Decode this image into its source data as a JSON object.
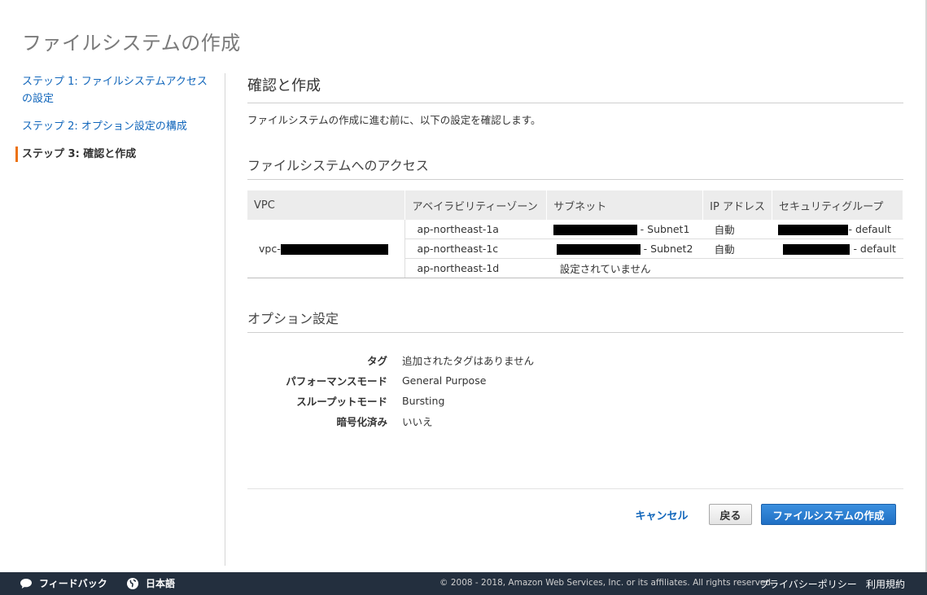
{
  "page_title": "ファイルシステムの作成",
  "sidebar": {
    "steps": [
      {
        "label": "ステップ 1: ファイルシステムアクセスの設定"
      },
      {
        "label": "ステップ 2: オプション設定の構成"
      },
      {
        "label": "ステップ 3: 確認と作成"
      }
    ]
  },
  "section": {
    "title": "確認と作成",
    "description": "ファイルシステムの作成に進む前に、以下の設定を確認します。"
  },
  "access": {
    "title": "ファイルシステムへのアクセス",
    "columns": [
      "VPC",
      "アベイラビリティーゾーン",
      "サブネット",
      "IP アドレス",
      "セキュリティグループ"
    ],
    "vpc_prefix": "vpc-",
    "rows": [
      {
        "az": "ap-northeast-1a",
        "subnet_suffix": "- Subnet1",
        "ip": "自動",
        "sg_suffix": "- default"
      },
      {
        "az": "ap-northeast-1c",
        "subnet_suffix": "- Subnet2",
        "ip": "自動",
        "sg_suffix": "- default"
      },
      {
        "az": "ap-northeast-1d",
        "subnet_text": "設定されていません"
      }
    ]
  },
  "options": {
    "title": "オプション設定",
    "items": [
      {
        "key": "タグ",
        "value": "追加されたタグはありません"
      },
      {
        "key": "パフォーマンスモード",
        "value": "General Purpose"
      },
      {
        "key": "スループットモード",
        "value": "Bursting"
      },
      {
        "key": "暗号化済み",
        "value": "いいえ"
      }
    ]
  },
  "buttons": {
    "cancel": "キャンセル",
    "back": "戻る",
    "create": "ファイルシステムの作成"
  },
  "footer": {
    "feedback": "フィードバック",
    "language": "日本語",
    "copyright": "© 2008 - 2018, Amazon Web Services, Inc. or its affiliates. All rights reserved.",
    "privacy": "プライバシーポリシー",
    "terms": "利用規約"
  }
}
